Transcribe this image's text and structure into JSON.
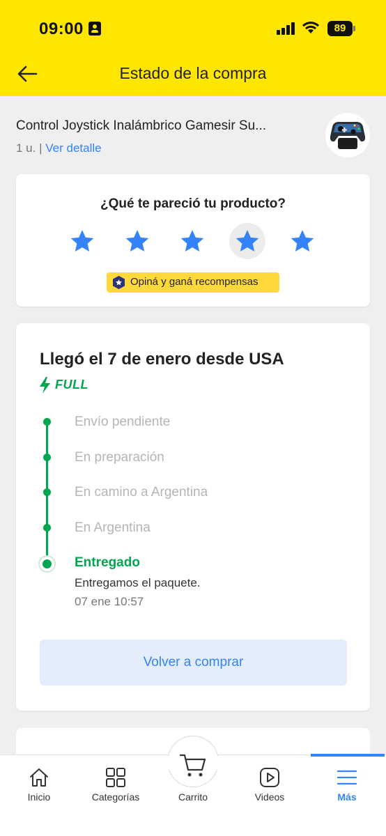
{
  "status_bar": {
    "time": "09:00",
    "battery": "89"
  },
  "header": {
    "title": "Estado de la compra"
  },
  "product": {
    "name": "Control Joystick Inalámbrico Gamesir Su...",
    "quantity": "1 u.",
    "separator": "|",
    "detail_link": "Ver detalle"
  },
  "rating": {
    "question": "¿Qué te pareció tu producto?",
    "stars_total": 5,
    "highlighted_star": 4,
    "reward_label": "Opiná y ganá recompensas"
  },
  "tracking": {
    "title": "Llegó el 7 de enero desde USA",
    "badge": "FULL",
    "steps": [
      {
        "label": "Envío pendiente",
        "state": "past"
      },
      {
        "label": "En preparación",
        "state": "past"
      },
      {
        "label": "En camino a Argentina",
        "state": "past"
      },
      {
        "label": "En Argentina",
        "state": "past"
      },
      {
        "label": "Entregado",
        "state": "current"
      }
    ],
    "current_detail": "Entregamos el paquete.",
    "current_time": "07 ene 10:57",
    "rebuy_label": "Volver a comprar"
  },
  "nav": {
    "items": [
      {
        "label": "Inicio",
        "icon": "home-icon"
      },
      {
        "label": "Categorías",
        "icon": "grid-icon"
      },
      {
        "label": "Carrito",
        "icon": "cart-icon"
      },
      {
        "label": "Videos",
        "icon": "video-icon"
      },
      {
        "label": "Más",
        "icon": "menu-icon"
      }
    ],
    "active": "Más"
  },
  "colors": {
    "header_yellow": "#fee600",
    "accent_blue": "#3483fa",
    "success_green": "#00a650",
    "badge_yellow": "#ffd83b"
  }
}
